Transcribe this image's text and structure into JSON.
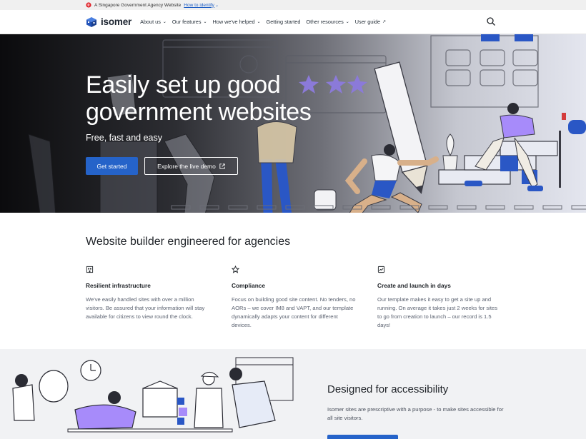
{
  "masthead": {
    "text": "A Singapore Government Agency Website",
    "link": "How to identify"
  },
  "nav": {
    "brand": "isomer",
    "items": [
      {
        "label": "About us",
        "suffix": "⌄"
      },
      {
        "label": "Our features",
        "suffix": "⌄"
      },
      {
        "label": "How we've helped",
        "suffix": "⌄"
      },
      {
        "label": "Getting started",
        "suffix": ""
      },
      {
        "label": "Other resources",
        "suffix": "⌄"
      },
      {
        "label": "User guide",
        "suffix": "↗"
      }
    ]
  },
  "hero": {
    "title": "Easily set up good government websites",
    "subtitle": "Free, fast and easy",
    "primary_button": "Get started",
    "secondary_button": "Explore the live demo"
  },
  "features": {
    "heading": "Website builder engineered for agencies",
    "items": [
      {
        "icon": "building-icon",
        "title": "Resilient infrastructure",
        "text": "We've easily handled sites with over a million visitors. Be assured that your information will stay available for citizens to view round the clock."
      },
      {
        "icon": "star-icon",
        "title": "Compliance",
        "text": "Focus on building good site content. No tenders, no AORs – we cover IM8 and VAPT, and our template dynamically adapts your content for different devices."
      },
      {
        "icon": "chart-icon",
        "title": "Create and launch in days",
        "text": "Our template makes it easy to get a site up and running. On average it takes just 2 weeks for sites to go from creation to launch – our record is 1.5 days!"
      }
    ]
  },
  "accessibility": {
    "heading": "Designed for accessibility",
    "text": "Isomer sites are prescriptive with a purpose - to make sites accessible for all site visitors."
  },
  "colors": {
    "primary": "#2563c9",
    "purple": "#a78bfa",
    "blue": "#2a57c5"
  }
}
